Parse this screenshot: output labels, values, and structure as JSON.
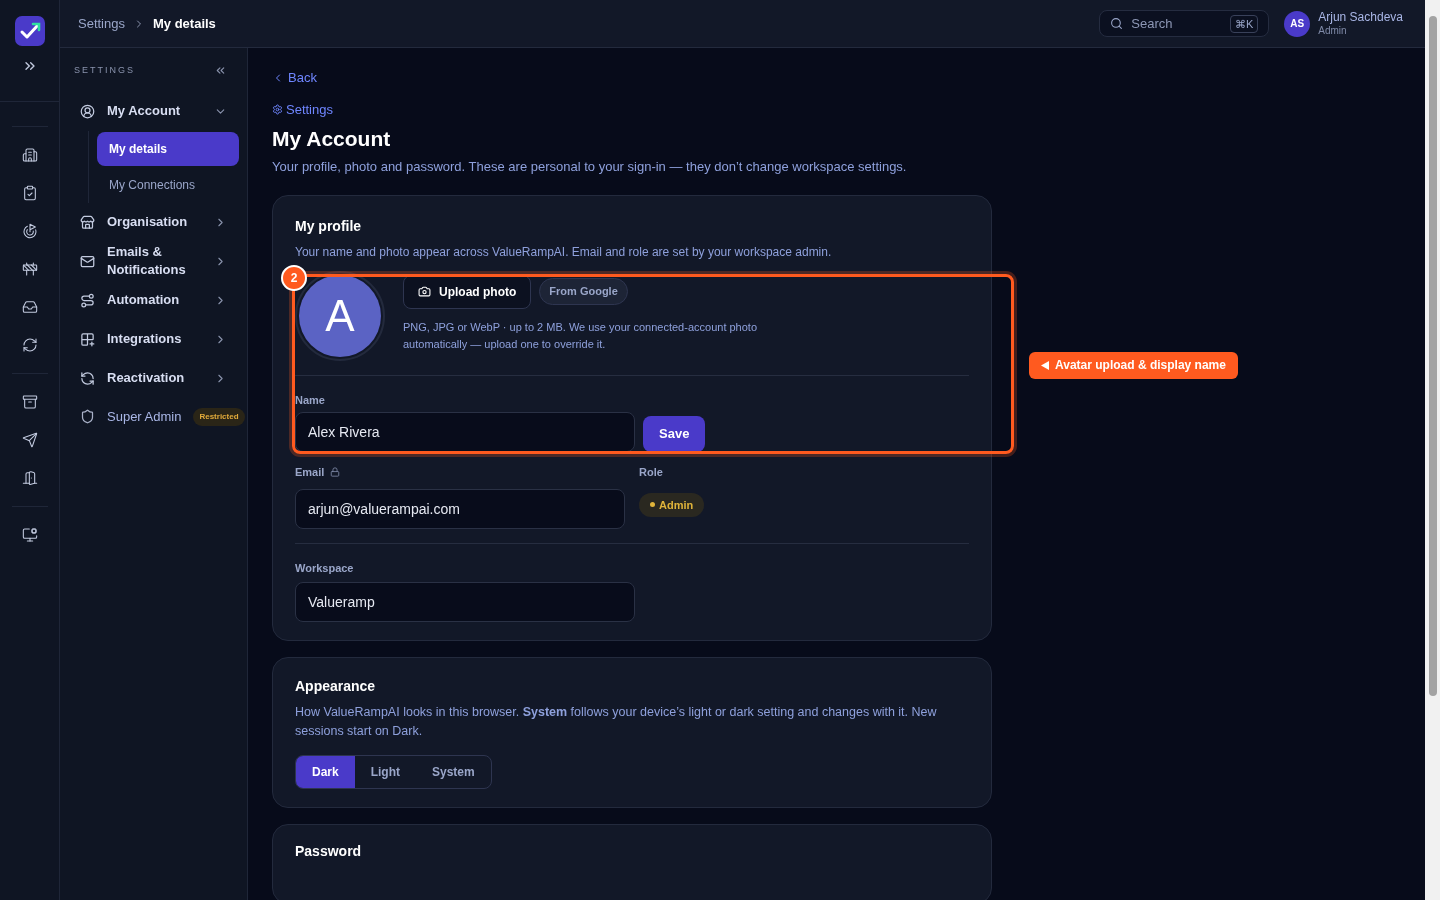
{
  "header": {
    "breadcrumb": [
      {
        "label": "Settings",
        "current": false
      },
      {
        "label": "My details",
        "current": true
      }
    ],
    "search": {
      "placeholder": "Search",
      "shortcut": "⌘K"
    },
    "user": {
      "initials": "AS",
      "name": "Arjun Sachdeva",
      "role": "Admin"
    }
  },
  "settings_nav": {
    "heading": "SETTINGS",
    "items": [
      {
        "kind": "group",
        "label": "My Account",
        "expanded": true,
        "children": [
          {
            "label": "My details",
            "selected": true
          },
          {
            "label": "My Connections",
            "selected": false
          }
        ]
      },
      {
        "kind": "group",
        "label": "Organisation",
        "expanded": false
      },
      {
        "kind": "group",
        "label": "Emails & Notifications",
        "expanded": false
      },
      {
        "kind": "group",
        "label": "Automation",
        "expanded": false
      },
      {
        "kind": "group",
        "label": "Integrations",
        "expanded": false
      },
      {
        "kind": "group",
        "label": "Reactivation",
        "expanded": false
      },
      {
        "kind": "link",
        "label": "Super Admin",
        "badge": "Restricted"
      }
    ]
  },
  "page": {
    "back": "Back",
    "section_link": "Settings",
    "title": "My Account",
    "subtitle": "Your profile, photo and password. These are personal to your sign-in — they don’t change workspace settings."
  },
  "profile": {
    "title": "My profile",
    "description": "Your name and photo appear across ValueRampAI. Email and role are set by your workspace admin.",
    "avatar_letter": "A",
    "upload_button": "Upload photo",
    "source_badge": "From Google",
    "hint": "PNG, JPG or WebP · up to 2 MB. We use your connected-account photo automatically — upload one to override it.",
    "name_label": "Name",
    "name_value": "Alex Rivera",
    "save_button": "Save",
    "email_label": "Email",
    "email_value": "arjun@valuerampai.com",
    "role_label": "Role",
    "role_badge": "Admin",
    "workspace_label": "Workspace",
    "workspace_value": "Valueramp"
  },
  "appearance": {
    "title": "Appearance",
    "description": "How ValueRampAI looks in this browser. **System** follows your device’s light or dark setting and changes with it. New sessions start on Dark.",
    "options": [
      {
        "label": "Dark",
        "selected": true
      },
      {
        "label": "Light",
        "selected": false
      },
      {
        "label": "System",
        "selected": false
      }
    ]
  },
  "password": {
    "title": "Password"
  },
  "annotation": {
    "step": "2",
    "callout": "Avatar upload & display name"
  }
}
